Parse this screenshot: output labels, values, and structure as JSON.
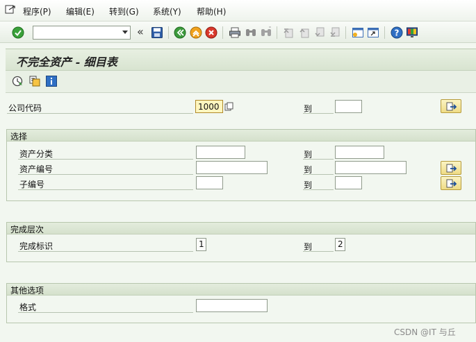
{
  "menu": {
    "items": [
      "程序(P)",
      "编辑(E)",
      "转到(G)",
      "系统(Y)",
      "帮助(H)"
    ]
  },
  "toolbar": {
    "command_value": "",
    "icons": [
      "enter-check-icon",
      "save-icon",
      "back-icon",
      "exit-icon",
      "cancel-icon",
      "print-icon",
      "find-icon",
      "find-next-icon",
      "first-page-icon",
      "previous-page-icon",
      "next-page-icon",
      "last-page-icon",
      "create-session-icon",
      "shortcut-icon",
      "help-icon",
      "customize-layout-icon"
    ]
  },
  "screen": {
    "title": "不完全资产 - 细目表"
  },
  "app_toolbar": {
    "icons": [
      "execute-icon",
      "get-variant-icon",
      "information-icon"
    ]
  },
  "company": {
    "label": "公司代码",
    "value": "1000",
    "to_label": "到",
    "to_value": ""
  },
  "selection": {
    "title": "选择",
    "rows": [
      {
        "label": "资产分类",
        "from": "",
        "to_label": "到",
        "to": ""
      },
      {
        "label": "资产编号",
        "from": "",
        "to_label": "到",
        "to": ""
      },
      {
        "label": "子编号",
        "from": "",
        "to_label": "到",
        "to": ""
      }
    ]
  },
  "completion": {
    "title": "完成层次",
    "label": "完成标识",
    "from": "1",
    "to_label": "到",
    "to": "2"
  },
  "other": {
    "title": "其他选项",
    "label": "格式",
    "value": ""
  },
  "watermark": "CSDN @IT 与丘"
}
